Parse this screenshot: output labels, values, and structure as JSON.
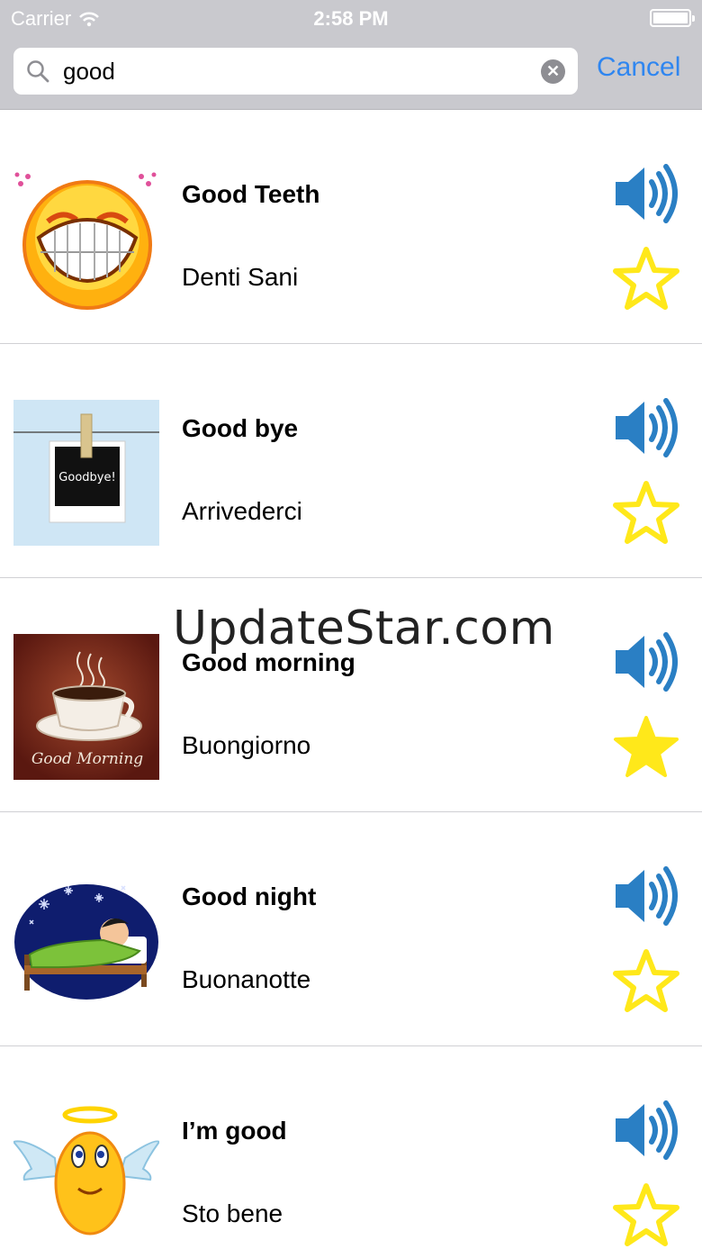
{
  "status_bar": {
    "carrier": "Carrier",
    "time": "2:58 PM"
  },
  "search": {
    "query": "good",
    "cancel_label": "Cancel"
  },
  "results": [
    {
      "title": "Good Teeth",
      "translation": "Denti Sani",
      "favorite": false,
      "image": "grinning-smiley"
    },
    {
      "title": "Good bye",
      "translation": "Arrivederci",
      "favorite": false,
      "image": "goodbye-polaroid",
      "image_text": "Goodbye!"
    },
    {
      "title": "Good morning",
      "translation": "Buongiorno",
      "favorite": true,
      "image": "coffee-cup",
      "image_text": "Good Morning"
    },
    {
      "title": "Good night",
      "translation": "Buonanotte",
      "favorite": false,
      "image": "sleeping-boy"
    },
    {
      "title": "I’m good",
      "translation": "Sto bene",
      "favorite": false,
      "image": "angel-smiley"
    }
  ],
  "watermark": "UpdateStar.com",
  "colors": {
    "accent": "#2f86f0",
    "speaker": "#2a7fc4",
    "star": "#ffe81a",
    "bar": "#c9c9ce"
  }
}
